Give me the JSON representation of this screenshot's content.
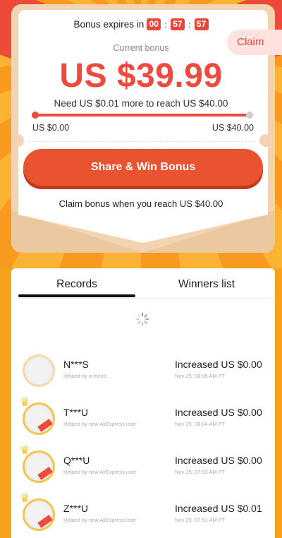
{
  "timer": {
    "label": "Bonus expires in",
    "hours": "00",
    "minutes": "57",
    "seconds": "57",
    "separator": ":"
  },
  "claim_label": "Claim",
  "bonus": {
    "label": "Current bonus",
    "amount": "US $39.99",
    "need_text": "Need US $0.01 more to reach US $40.00",
    "progress_fraction": 0.99975,
    "range_min": "US $0.00",
    "range_max": "US $40.00"
  },
  "share_button_label": "Share & Win Bonus",
  "claim_when_text": "Claim bonus when you reach US $40.00",
  "tabs": [
    {
      "label": "Records",
      "active": true
    },
    {
      "label": "Winners list",
      "active": false
    }
  ],
  "records": [
    {
      "name": "N***S",
      "sub": "Helped by a friend",
      "amount": "Increased US $0.00",
      "date": "Nov 25, 08:05 AM PT",
      "new_user": false
    },
    {
      "name": "T***U",
      "sub": "Helped by new AliExpress user",
      "amount": "Increased US $0.00",
      "date": "Nov 25, 08:04 AM PT",
      "new_user": true
    },
    {
      "name": "Q***U",
      "sub": "Helped by new AliExpress user",
      "amount": "Increased US $0.00",
      "date": "Nov 25, 07:53 AM PT",
      "new_user": true
    },
    {
      "name": "Z***U",
      "sub": "Helped by new AliExpress user",
      "amount": "Increased US $0.01",
      "date": "Nov 25, 07:51 AM PT",
      "new_user": true
    }
  ],
  "colors": {
    "accent_red": "#ef4a3e",
    "button_orange": "#e9532f",
    "background_orange": "#f7a21d"
  }
}
